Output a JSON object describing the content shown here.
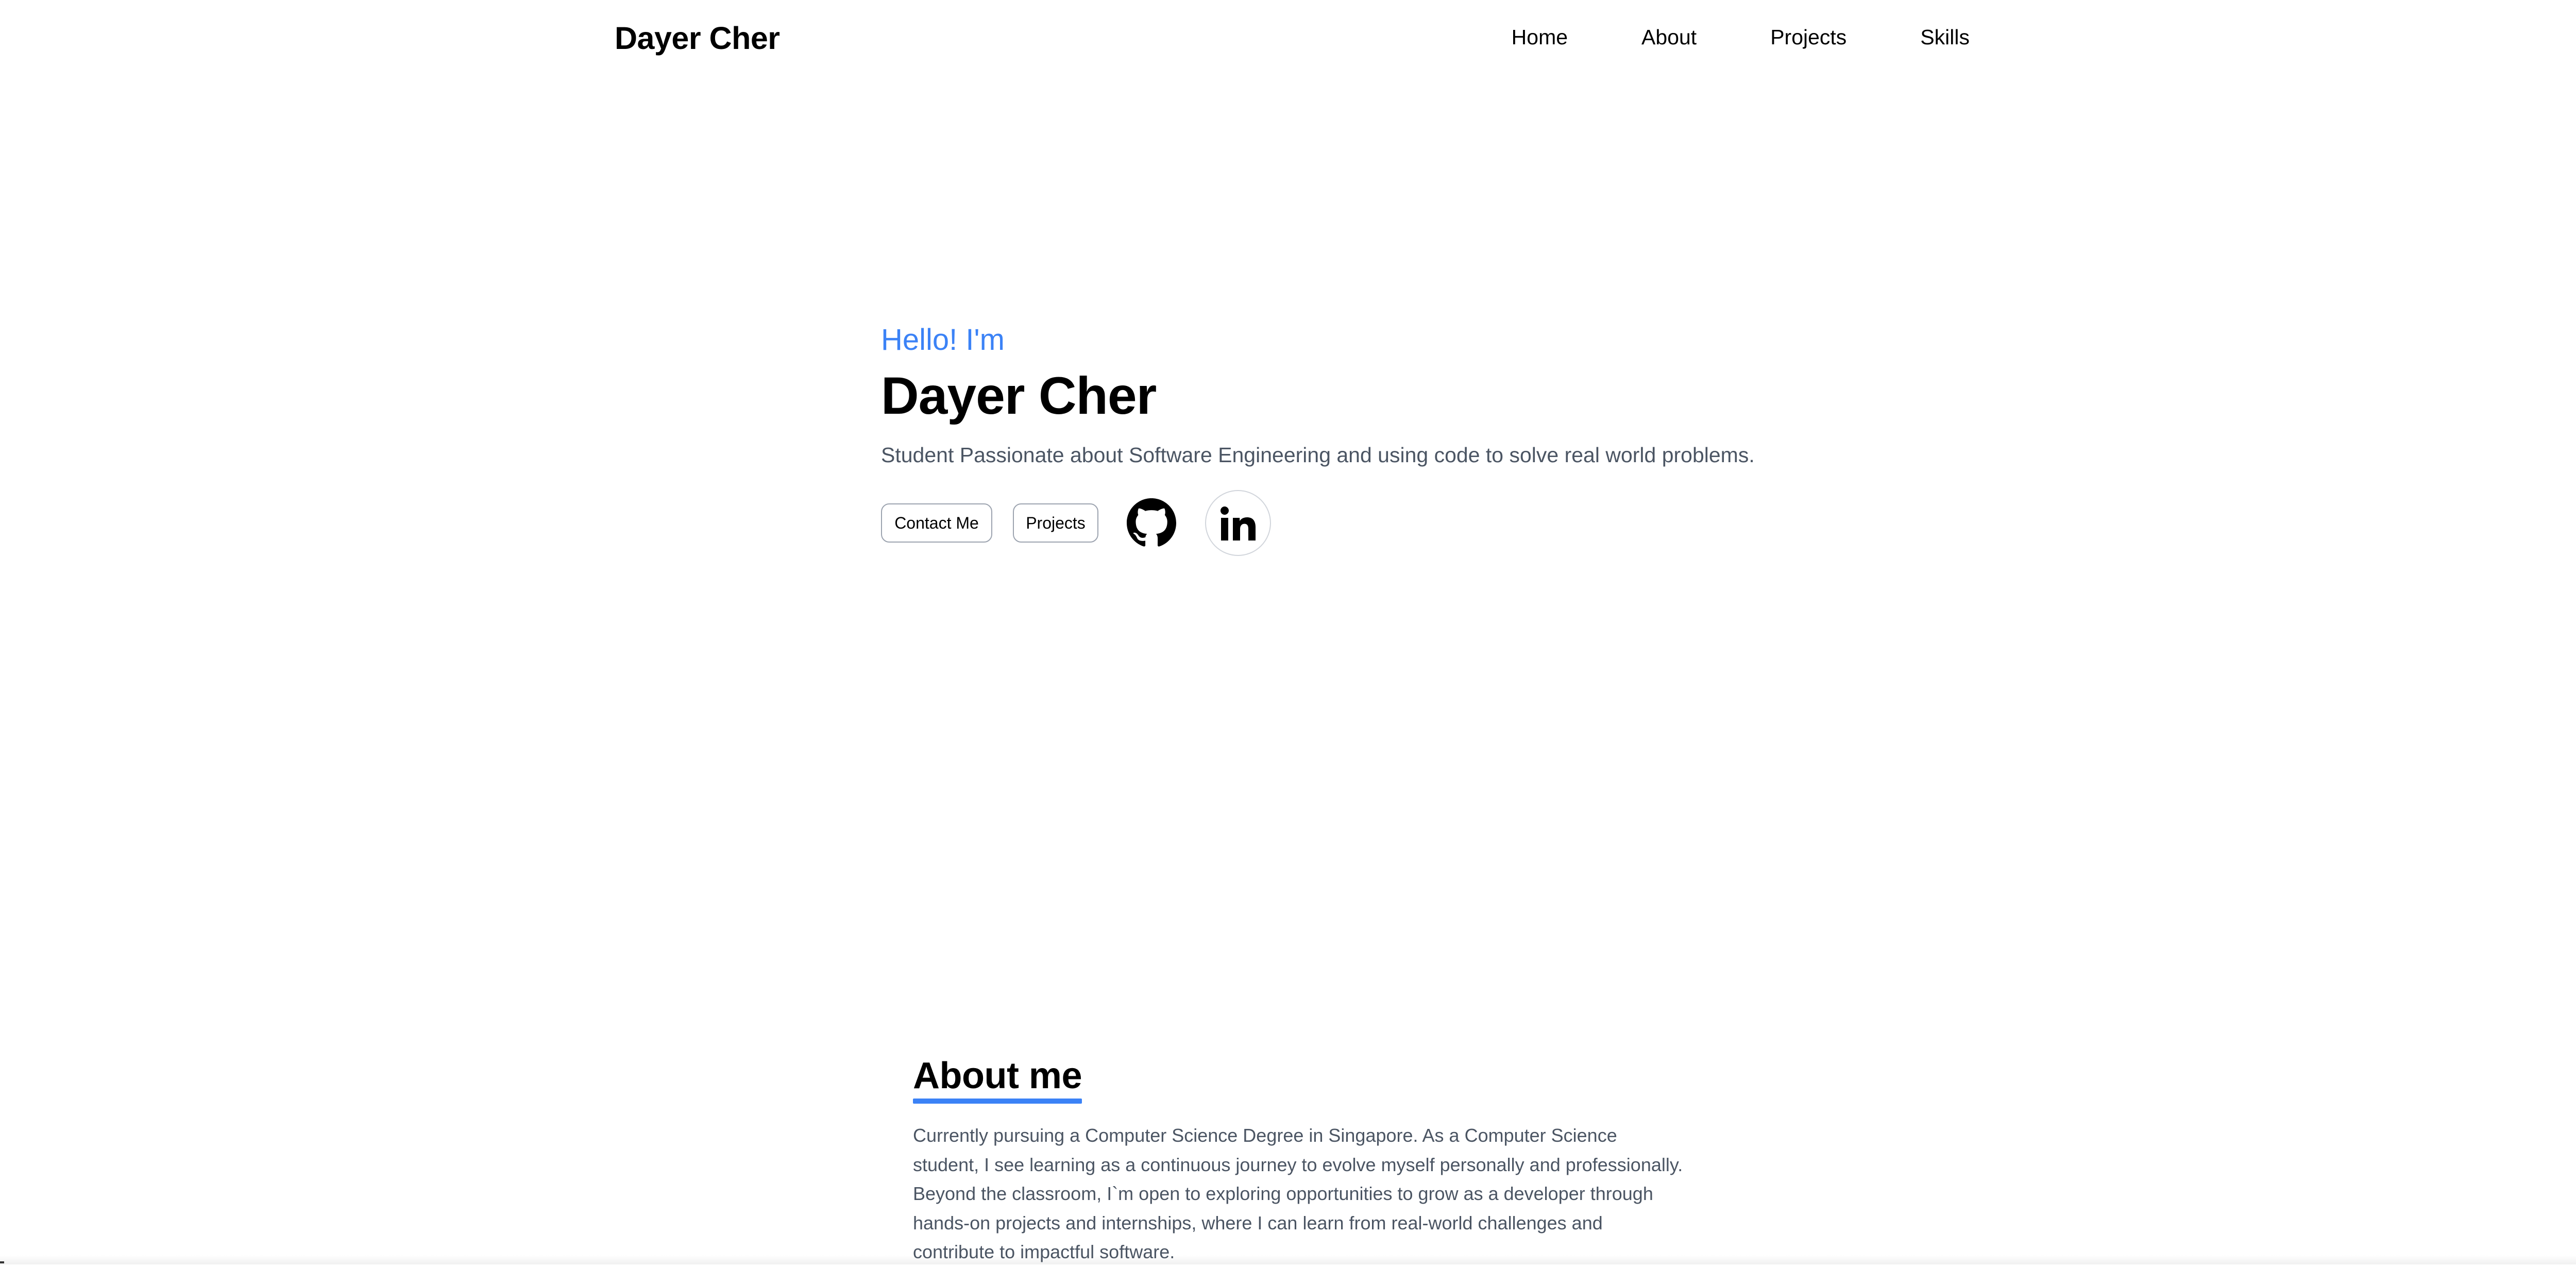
{
  "header": {
    "brand": "Dayer Cher",
    "nav": [
      "Home",
      "About",
      "Projects",
      "Skills"
    ]
  },
  "hero": {
    "greeting": "Hello! I'm",
    "name": "Dayer Cher",
    "tagline": "Student Passionate about Software Engineering and using code to solve real world problems.",
    "contact_label": "Contact Me",
    "projects_label": "Projects",
    "github_icon": "github-icon",
    "linkedin_icon": "linkedin-icon"
  },
  "about": {
    "heading": "About me",
    "lines": [
      "Currently pursuing a Computer Science Degree in Singapore. As a Computer Science",
      "student, I see learning as a continuous journey to evolve myself personally and professionally.",
      "Beyond the classroom, I`m open to exploring opportunities to grow as a developer through",
      "hands-on projects and internships, where I can learn from real-world challenges and",
      "contribute to impactful software."
    ]
  },
  "colors": {
    "accent": "#3b82f6",
    "muted_text": "#4b5563",
    "text": "#000000"
  }
}
